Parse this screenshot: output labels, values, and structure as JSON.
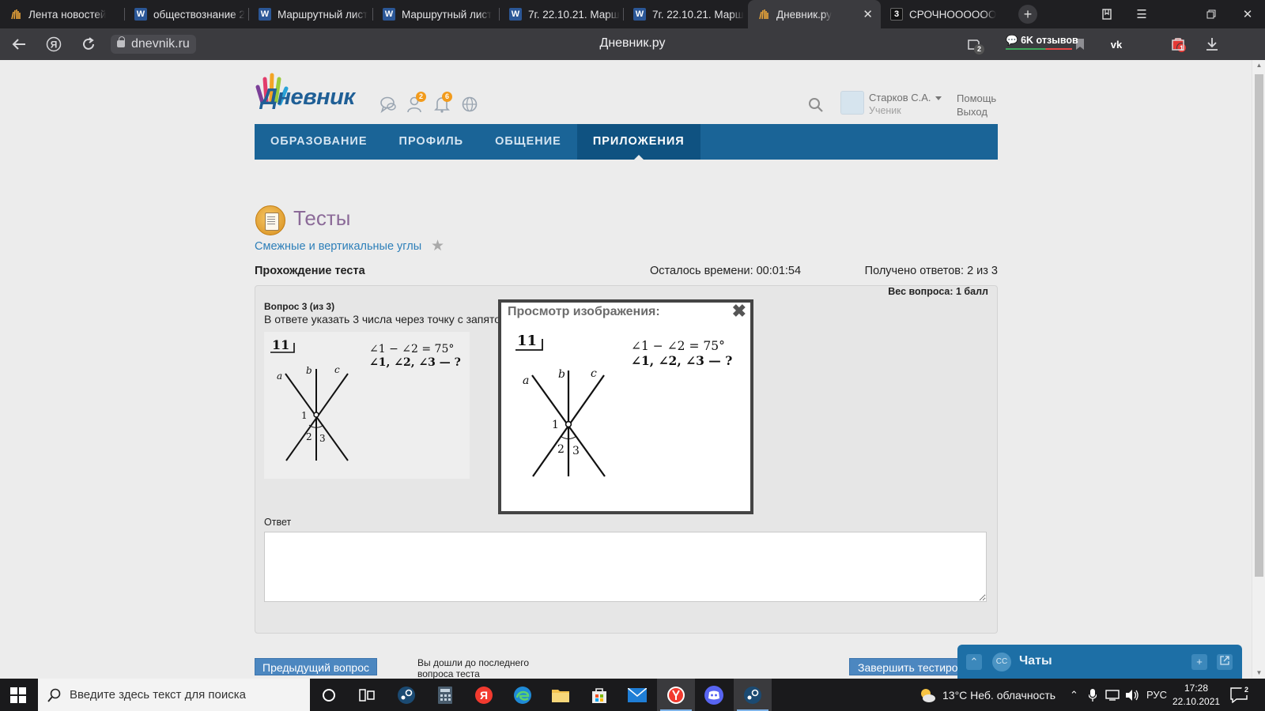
{
  "browser": {
    "tabs": [
      {
        "label": "Лента новостей",
        "favicon": "dnevnik-favicon"
      },
      {
        "label": "обществознание 2",
        "favicon": "word-icon"
      },
      {
        "label": "Маршрутный лист",
        "favicon": "word-icon"
      },
      {
        "label": "Маршрутный лист",
        "favicon": "word-icon"
      },
      {
        "label": "7г. 22.10.21. Марш",
        "favicon": "word-icon"
      },
      {
        "label": "7г. 22.10.21. Марш",
        "favicon": "word-icon"
      },
      {
        "label": "Дневник.ру",
        "favicon": "dnevnik-favicon",
        "active": true
      },
      {
        "label": "СРОЧНОООООО",
        "favicon": "znanija-favicon"
      }
    ],
    "address": "dnevnik.ru",
    "page_title": "Дневник.ру",
    "reviews_label": "6K отзывов",
    "protect_badge": "2",
    "alice_badge": "1"
  },
  "site": {
    "logo_text": "Дневник",
    "icons": [
      "chat-icon",
      "friends-icon",
      "notifications-icon",
      "globe-icon"
    ],
    "friends_badge": "2",
    "notifications_badge": "6",
    "user_name": "Старков С.А.",
    "user_role": "Ученик",
    "help_link": "Помощь",
    "logout_link": "Выход",
    "nav": [
      {
        "label": "ОБРАЗОВАНИЕ"
      },
      {
        "label": "ПРОФИЛЬ"
      },
      {
        "label": "ОБЩЕНИЕ"
      },
      {
        "label": "ПРИЛОЖЕНИЯ",
        "active": true
      }
    ]
  },
  "test": {
    "section_title": "Тесты",
    "test_name": "Смежные и вертикальные углы",
    "mode_label": "Прохождение теста",
    "time_left": "Осталось времени: 00:01:54",
    "answers_received": "Получено ответов: 2 из 3",
    "question_weight": "Вес вопроса: 1 балл",
    "question_number": "Вопрос 3 (из 3)",
    "question_text": "В ответе указать 3 числа через точку с запятой",
    "answer_label": "Ответ",
    "answer_value": "",
    "prev_button": "Предыдущий вопрос",
    "last_note": "Вы дошли до последнего вопроса теста",
    "finish_button": "Завершить тестирование"
  },
  "figure": {
    "number": "11",
    "condition": "∠1 − ∠2 = 75°",
    "question": "∠1, ∠2, ∠3 — ?",
    "line_labels": [
      "a",
      "b",
      "c"
    ],
    "angle_labels": [
      "1",
      "2",
      "3"
    ]
  },
  "modal": {
    "title": "Просмотр изображения:"
  },
  "chats": {
    "title": "Чаты",
    "initials": "СС"
  },
  "taskbar": {
    "search_placeholder": "Введите здесь текст для поиска",
    "weather": "13°C  Неб. облачность",
    "language": "РУС",
    "time": "17:28",
    "date": "22.10.2021",
    "notification_count": "2",
    "apps": [
      "task-view-icon",
      "steam-icon",
      "calculator-icon",
      "yandex-icon",
      "edge-icon",
      "explorer-icon",
      "store-icon",
      "mail-icon",
      "yandex-browser-icon",
      "discord-icon",
      "steam-icon-2"
    ]
  }
}
